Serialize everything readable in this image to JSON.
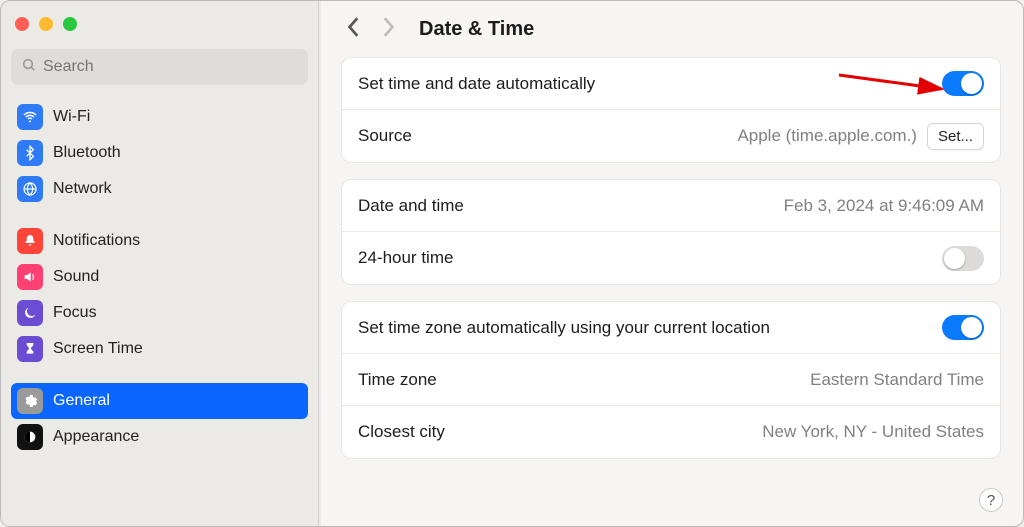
{
  "header": {
    "title": "Date & Time"
  },
  "search": {
    "placeholder": "Search"
  },
  "sidebar": {
    "items": [
      {
        "label": "Wi-Fi"
      },
      {
        "label": "Bluetooth"
      },
      {
        "label": "Network"
      },
      {
        "label": "Notifications"
      },
      {
        "label": "Sound"
      },
      {
        "label": "Focus"
      },
      {
        "label": "Screen Time"
      },
      {
        "label": "General"
      },
      {
        "label": "Appearance"
      }
    ]
  },
  "rows": {
    "set_auto_label": "Set time and date automatically",
    "source_label": "Source",
    "source_value": "Apple (time.apple.com.)",
    "set_button": "Set...",
    "date_time_label": "Date and time",
    "date_time_value": "Feb 3, 2024 at 9:46:09 AM",
    "h24_label": "24-hour time",
    "tz_auto_label": "Set time zone automatically using your current location",
    "tz_label": "Time zone",
    "tz_value": "Eastern Standard Time",
    "city_label": "Closest city",
    "city_value": "New York, NY - United States"
  },
  "toggles": {
    "set_auto": true,
    "h24": false,
    "tz_auto": true
  },
  "help_label": "?"
}
